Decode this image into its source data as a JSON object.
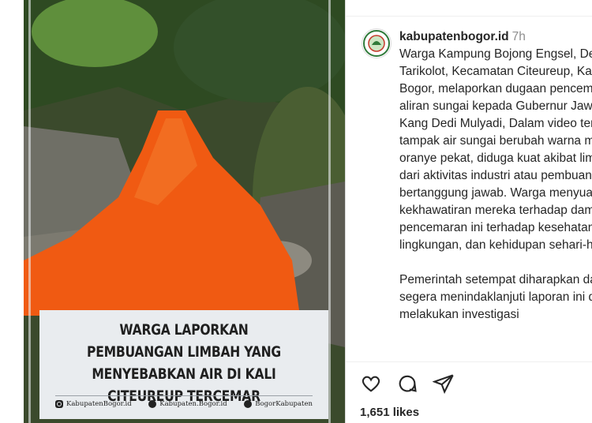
{
  "image": {
    "headline": "WARGA LAPORKAN PEMBUANGAN LIMBAH YANG MENYEBABKAN AIR DI KALI CITEUREUP TERCEMAR",
    "footer": {
      "instagram": "KabupatenBogor.id",
      "tiktok": "Kabupaten.Bogor.id",
      "twitter": "BogorKabupaten"
    },
    "icons": [
      "instagram-icon",
      "tiktok-icon",
      "twitter-icon"
    ]
  },
  "post": {
    "username": "kabupatenbogor.id",
    "time": "7h",
    "caption_p1": "Warga Kampung Bojong Engsel, Desa Tarikolot, Kecamatan Citeureup, Kabupaten Bogor, melaporkan dugaan pencemaran aliran sungai kepada Gubernur Jawa Barat, Kang Dedi Mulyadi, Dalam video tersebut, tampak air sungai berubah warna menjadi oranye pekat, diduga kuat akibat limbah dari aktivitas industri atau pembuangan tak bertanggung jawab. Warga menyuarakan kekhawatiran mereka terhadap dampak pencemaran ini terhadap kesehatan, lingkungan, dan kehidupan sehari-hari.",
    "caption_p2": "Pemerintah setempat diharapkan dapat segera menindaklanjuti laporan ini dengan melakukan investigasi",
    "likes": "1,651 likes",
    "icons": [
      "heart-icon",
      "comment-icon",
      "share-icon"
    ],
    "colors": {
      "text": "#262626",
      "muted": "#8e8e8e",
      "river": "#f05a12"
    }
  }
}
